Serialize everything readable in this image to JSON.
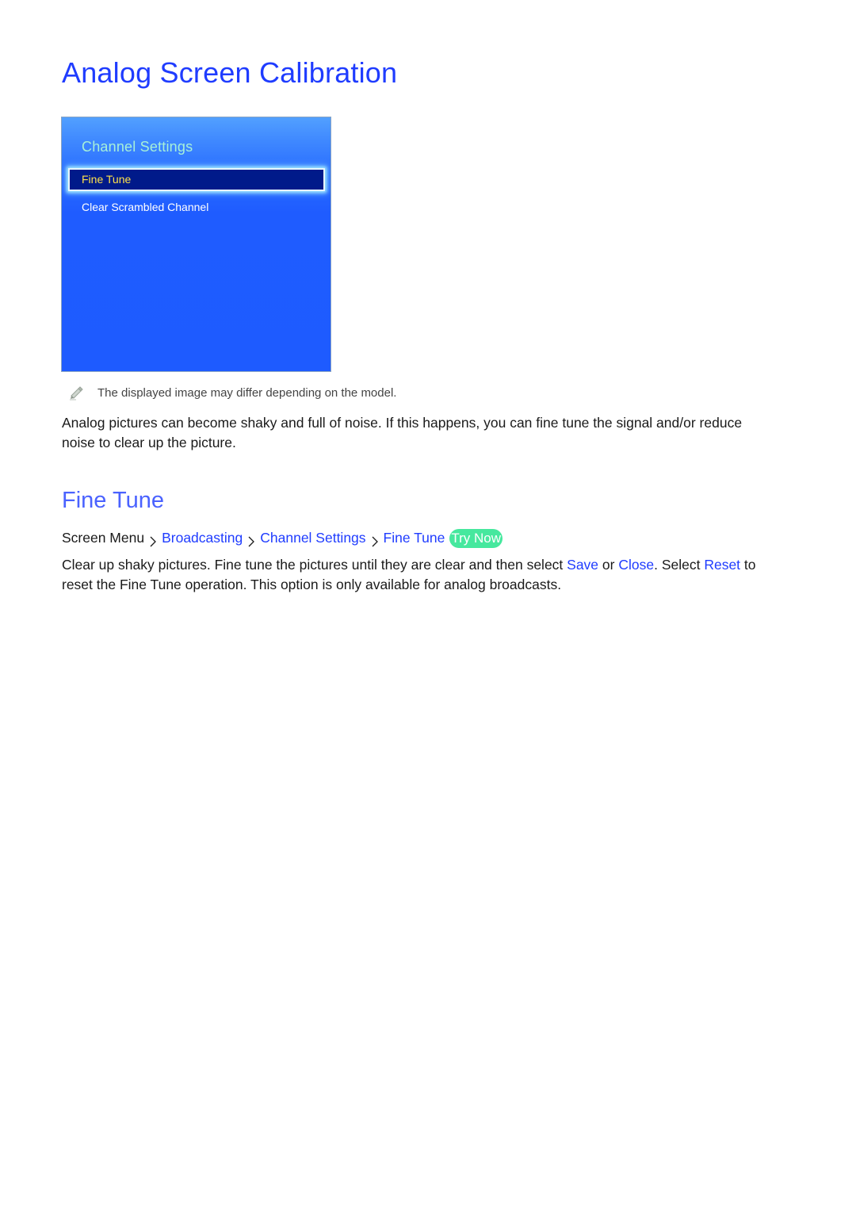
{
  "page": {
    "title": "Analog Screen Calibration"
  },
  "tv_menu": {
    "title": "Channel Settings",
    "items": [
      {
        "label": "Fine Tune",
        "selected": true
      },
      {
        "label": "Clear Scrambled Channel",
        "selected": false
      }
    ],
    "colors": {
      "background": "#1e5bff",
      "title": "#a6f0d8",
      "selected_bg": "#001a8a",
      "selected_text": "#ffe24a"
    }
  },
  "note": {
    "icon": "pencil-icon",
    "text": "The displayed image may differ depending on the model."
  },
  "intro": {
    "text": "Analog pictures can become shaky and full of noise. If this happens, you can fine tune the signal and/or reduce noise to clear up the picture."
  },
  "section": {
    "title": "Fine Tune",
    "breadcrumb": {
      "items": [
        "Screen Menu",
        "Broadcasting",
        "Channel Settings",
        "Fine Tune"
      ],
      "separator_icon": "chevron-right-icon",
      "try_now": "Try Now"
    },
    "description": {
      "part1": "Clear up shaky pictures. Fine tune the pictures until they are clear and then select ",
      "save": "Save",
      "part2": " or ",
      "close": "Close",
      "part3": ". Select ",
      "reset": "Reset",
      "part4": " to reset the Fine Tune operation. This option is only available for analog broadcasts."
    }
  },
  "colors": {
    "accent": "#1f3cff",
    "section_title": "#4a62ff",
    "try_now_bg": "#46e89e"
  }
}
